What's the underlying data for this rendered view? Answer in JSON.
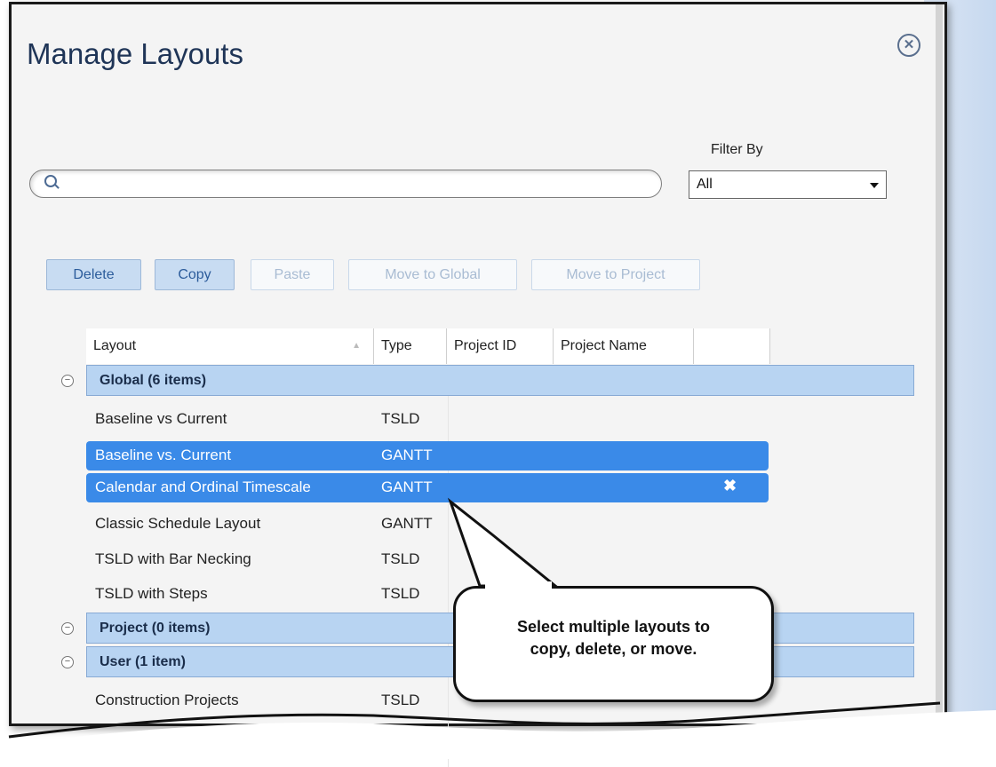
{
  "dialog": {
    "title": "Manage Layouts"
  },
  "search": {
    "value": "",
    "placeholder": ""
  },
  "filter": {
    "label": "Filter By",
    "value": "All"
  },
  "toolbar": {
    "delete_label": "Delete",
    "copy_label": "Copy",
    "paste_label": "Paste",
    "move_global_label": "Move to Global",
    "move_project_label": "Move to Project"
  },
  "table": {
    "columns": [
      "Layout",
      "Type",
      "Project ID",
      "Project Name"
    ],
    "groups": [
      {
        "label": "Global (6 items)",
        "rows": [
          {
            "layout": "Baseline vs Current",
            "type": "TSLD"
          },
          {
            "layout": "Baseline vs. Current",
            "type": "GANTT"
          },
          {
            "layout": "Calendar and Ordinal Timescale",
            "type": "GANTT"
          },
          {
            "layout": "Classic Schedule Layout",
            "type": "GANTT"
          },
          {
            "layout": "TSLD with Bar Necking",
            "type": "TSLD"
          },
          {
            "layout": "TSLD with Steps",
            "type": "TSLD"
          }
        ]
      },
      {
        "label": "Project (0 items)",
        "rows": []
      },
      {
        "label": "User (1 item)",
        "rows": [
          {
            "layout": "Construction Projects",
            "type": "TSLD"
          }
        ]
      }
    ]
  },
  "callout": {
    "line1": "Select multiple layouts to",
    "line2": "copy, delete, or move."
  },
  "colors": {
    "selection": "#3a8ae8",
    "group_header": "#b8d4f2",
    "title": "#1f3557"
  }
}
